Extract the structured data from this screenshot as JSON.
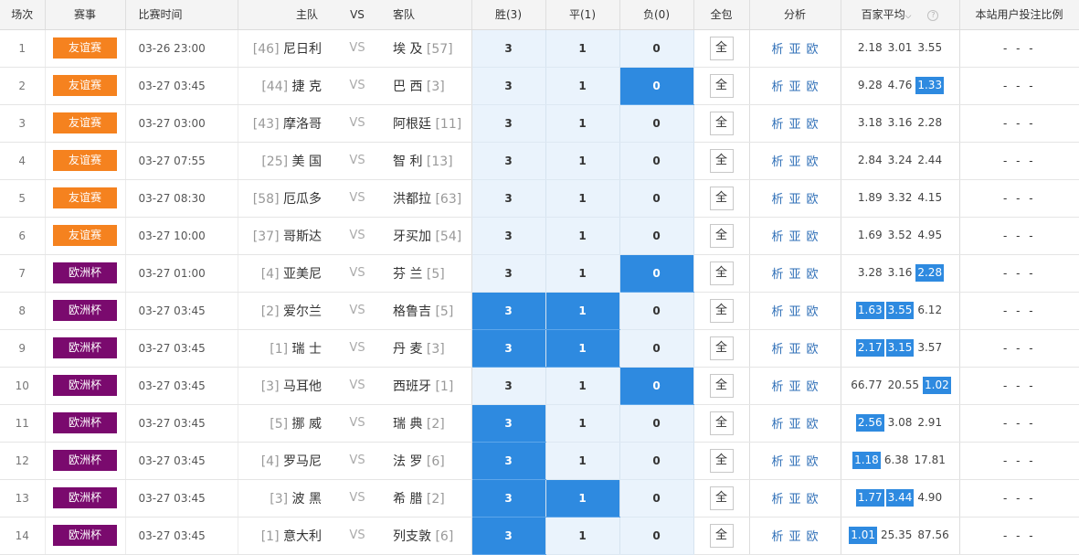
{
  "headers": {
    "no": "场次",
    "event": "赛事",
    "time": "比赛时间",
    "home": "主队",
    "vs": "VS",
    "away": "客队",
    "win": "胜(3)",
    "draw": "平(1)",
    "lose": "负(0)",
    "all": "全包",
    "analysis": "分析",
    "avg_odds": "百家平均",
    "ratio": "本站用户投注比例"
  },
  "icons": {
    "sort": "chevron-down-icon",
    "help": "help-icon"
  },
  "colors": {
    "friendly": "#f5821f",
    "euro": "#7a0a6e",
    "selected": "#2e8ae0",
    "cell_bg": "#eaf3fc",
    "link": "#2f6fb7"
  },
  "rows": [
    {
      "no": "1",
      "event": "友谊赛",
      "event_type": "friendly",
      "time": "03-26 23:00",
      "home_rank": "[46]",
      "home": "尼日利",
      "vs": "VS",
      "away": "埃 及",
      "away_rank": "[57]",
      "w": "3",
      "d": "1",
      "l": "0",
      "sel": [
        false,
        false,
        false
      ],
      "all": "全",
      "a1": "析",
      "a2": "亚",
      "a3": "欧",
      "odds": [
        "2.18",
        "3.01",
        "3.55"
      ],
      "hl": [
        false,
        false,
        false
      ],
      "ratio": "- - -"
    },
    {
      "no": "2",
      "event": "友谊赛",
      "event_type": "friendly",
      "time": "03-27 03:45",
      "home_rank": "[44]",
      "home": "捷 克",
      "vs": "VS",
      "away": "巴 西",
      "away_rank": "[3]",
      "w": "3",
      "d": "1",
      "l": "0",
      "sel": [
        false,
        false,
        true
      ],
      "all": "全",
      "a1": "析",
      "a2": "亚",
      "a3": "欧",
      "odds": [
        "9.28",
        "4.76",
        "1.33"
      ],
      "hl": [
        false,
        false,
        true
      ],
      "ratio": "- - -"
    },
    {
      "no": "3",
      "event": "友谊赛",
      "event_type": "friendly",
      "time": "03-27 03:00",
      "home_rank": "[43]",
      "home": "摩洛哥",
      "vs": "VS",
      "away": "阿根廷",
      "away_rank": "[11]",
      "w": "3",
      "d": "1",
      "l": "0",
      "sel": [
        false,
        false,
        false
      ],
      "all": "全",
      "a1": "析",
      "a2": "亚",
      "a3": "欧",
      "odds": [
        "3.18",
        "3.16",
        "2.28"
      ],
      "hl": [
        false,
        false,
        false
      ],
      "ratio": "- - -"
    },
    {
      "no": "4",
      "event": "友谊赛",
      "event_type": "friendly",
      "time": "03-27 07:55",
      "home_rank": "[25]",
      "home": "美 国",
      "vs": "VS",
      "away": "智 利",
      "away_rank": "[13]",
      "w": "3",
      "d": "1",
      "l": "0",
      "sel": [
        false,
        false,
        false
      ],
      "all": "全",
      "a1": "析",
      "a2": "亚",
      "a3": "欧",
      "odds": [
        "2.84",
        "3.24",
        "2.44"
      ],
      "hl": [
        false,
        false,
        false
      ],
      "ratio": "- - -"
    },
    {
      "no": "5",
      "event": "友谊赛",
      "event_type": "friendly",
      "time": "03-27 08:30",
      "home_rank": "[58]",
      "home": "厄瓜多",
      "vs": "VS",
      "away": "洪都拉",
      "away_rank": "[63]",
      "w": "3",
      "d": "1",
      "l": "0",
      "sel": [
        false,
        false,
        false
      ],
      "all": "全",
      "a1": "析",
      "a2": "亚",
      "a3": "欧",
      "odds": [
        "1.89",
        "3.32",
        "4.15"
      ],
      "hl": [
        false,
        false,
        false
      ],
      "ratio": "- - -"
    },
    {
      "no": "6",
      "event": "友谊赛",
      "event_type": "friendly",
      "time": "03-27 10:00",
      "home_rank": "[37]",
      "home": "哥斯达",
      "vs": "VS",
      "away": "牙买加",
      "away_rank": "[54]",
      "w": "3",
      "d": "1",
      "l": "0",
      "sel": [
        false,
        false,
        false
      ],
      "all": "全",
      "a1": "析",
      "a2": "亚",
      "a3": "欧",
      "odds": [
        "1.69",
        "3.52",
        "4.95"
      ],
      "hl": [
        false,
        false,
        false
      ],
      "ratio": "- - -"
    },
    {
      "no": "7",
      "event": "欧洲杯",
      "event_type": "euro",
      "time": "03-27 01:00",
      "home_rank": "[4]",
      "home": "亚美尼",
      "vs": "VS",
      "away": "芬 兰",
      "away_rank": "[5]",
      "w": "3",
      "d": "1",
      "l": "0",
      "sel": [
        false,
        false,
        true
      ],
      "all": "全",
      "a1": "析",
      "a2": "亚",
      "a3": "欧",
      "odds": [
        "3.28",
        "3.16",
        "2.28"
      ],
      "hl": [
        false,
        false,
        true
      ],
      "ratio": "- - -"
    },
    {
      "no": "8",
      "event": "欧洲杯",
      "event_type": "euro",
      "time": "03-27 03:45",
      "home_rank": "[2]",
      "home": "爱尔兰",
      "vs": "VS",
      "away": "格鲁吉",
      "away_rank": "[5]",
      "w": "3",
      "d": "1",
      "l": "0",
      "sel": [
        true,
        true,
        false
      ],
      "all": "全",
      "a1": "析",
      "a2": "亚",
      "a3": "欧",
      "odds": [
        "1.63",
        "3.55",
        "6.12"
      ],
      "hl": [
        true,
        true,
        false
      ],
      "ratio": "- - -"
    },
    {
      "no": "9",
      "event": "欧洲杯",
      "event_type": "euro",
      "time": "03-27 03:45",
      "home_rank": "[1]",
      "home": "瑞 士",
      "vs": "VS",
      "away": "丹 麦",
      "away_rank": "[3]",
      "w": "3",
      "d": "1",
      "l": "0",
      "sel": [
        true,
        true,
        false
      ],
      "all": "全",
      "a1": "析",
      "a2": "亚",
      "a3": "欧",
      "odds": [
        "2.17",
        "3.15",
        "3.57"
      ],
      "hl": [
        true,
        true,
        false
      ],
      "ratio": "- - -"
    },
    {
      "no": "10",
      "event": "欧洲杯",
      "event_type": "euro",
      "time": "03-27 03:45",
      "home_rank": "[3]",
      "home": "马耳他",
      "vs": "VS",
      "away": "西班牙",
      "away_rank": "[1]",
      "w": "3",
      "d": "1",
      "l": "0",
      "sel": [
        false,
        false,
        true
      ],
      "all": "全",
      "a1": "析",
      "a2": "亚",
      "a3": "欧",
      "odds": [
        "66.77",
        "20.55",
        "1.02"
      ],
      "hl": [
        false,
        false,
        true
      ],
      "ratio": "- - -"
    },
    {
      "no": "11",
      "event": "欧洲杯",
      "event_type": "euro",
      "time": "03-27 03:45",
      "home_rank": "[5]",
      "home": "挪 威",
      "vs": "VS",
      "away": "瑞 典",
      "away_rank": "[2]",
      "w": "3",
      "d": "1",
      "l": "0",
      "sel": [
        true,
        false,
        false
      ],
      "all": "全",
      "a1": "析",
      "a2": "亚",
      "a3": "欧",
      "odds": [
        "2.56",
        "3.08",
        "2.91"
      ],
      "hl": [
        true,
        false,
        false
      ],
      "ratio": "- - -"
    },
    {
      "no": "12",
      "event": "欧洲杯",
      "event_type": "euro",
      "time": "03-27 03:45",
      "home_rank": "[4]",
      "home": "罗马尼",
      "vs": "VS",
      "away": "法 罗",
      "away_rank": "[6]",
      "w": "3",
      "d": "1",
      "l": "0",
      "sel": [
        true,
        false,
        false
      ],
      "all": "全",
      "a1": "析",
      "a2": "亚",
      "a3": "欧",
      "odds": [
        "1.18",
        "6.38",
        "17.81"
      ],
      "hl": [
        true,
        false,
        false
      ],
      "ratio": "- - -"
    },
    {
      "no": "13",
      "event": "欧洲杯",
      "event_type": "euro",
      "time": "03-27 03:45",
      "home_rank": "[3]",
      "home": "波 黑",
      "vs": "VS",
      "away": "希 腊",
      "away_rank": "[2]",
      "w": "3",
      "d": "1",
      "l": "0",
      "sel": [
        true,
        true,
        false
      ],
      "all": "全",
      "a1": "析",
      "a2": "亚",
      "a3": "欧",
      "odds": [
        "1.77",
        "3.44",
        "4.90"
      ],
      "hl": [
        true,
        true,
        false
      ],
      "ratio": "- - -"
    },
    {
      "no": "14",
      "event": "欧洲杯",
      "event_type": "euro",
      "time": "03-27 03:45",
      "home_rank": "[1]",
      "home": "意大利",
      "vs": "VS",
      "away": "列支敦",
      "away_rank": "[6]",
      "w": "3",
      "d": "1",
      "l": "0",
      "sel": [
        true,
        false,
        false
      ],
      "all": "全",
      "a1": "析",
      "a2": "亚",
      "a3": "欧",
      "odds": [
        "1.01",
        "25.35",
        "87.56"
      ],
      "hl": [
        true,
        false,
        false
      ],
      "ratio": "- - -"
    }
  ]
}
